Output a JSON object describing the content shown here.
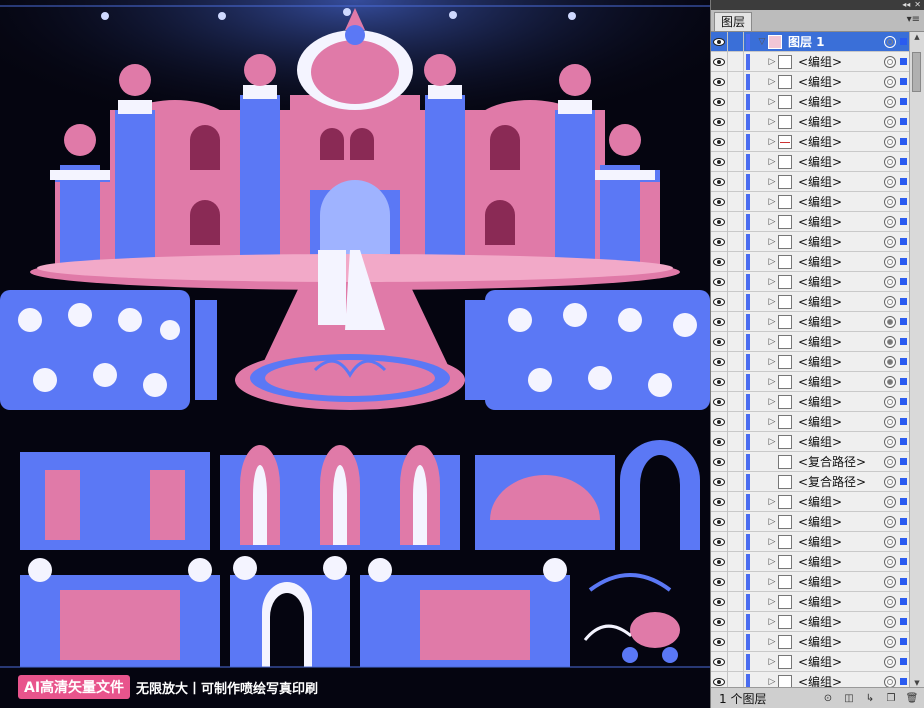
{
  "canvas": {
    "banner": {
      "badge": "AI高清矢量文件",
      "tagline": "无限放大丨可制作喷绘写真印刷"
    },
    "colors": {
      "blue": "#5b78f5",
      "pink": "#e07aa8",
      "white": "#f4f4ff",
      "bg": "#050510"
    }
  },
  "panel": {
    "tab_label": "图层",
    "footer_count": "1 个图层",
    "layers": [
      {
        "name": "图层 1",
        "kind": "layer"
      },
      {
        "name": "<编组>",
        "kind": "group",
        "thumb": "plain",
        "target": "empty"
      },
      {
        "name": "<编组>",
        "kind": "group",
        "thumb": "plain",
        "target": "empty"
      },
      {
        "name": "<编组>",
        "kind": "group",
        "thumb": "plain",
        "target": "empty"
      },
      {
        "name": "<编组>",
        "kind": "group",
        "thumb": "plain",
        "target": "empty"
      },
      {
        "name": "<编组>",
        "kind": "group",
        "thumb": "red",
        "target": "empty"
      },
      {
        "name": "<编组>",
        "kind": "group",
        "thumb": "plain",
        "target": "empty"
      },
      {
        "name": "<编组>",
        "kind": "group",
        "thumb": "plain",
        "target": "empty"
      },
      {
        "name": "<编组>",
        "kind": "group",
        "thumb": "plain",
        "target": "empty"
      },
      {
        "name": "<编组>",
        "kind": "group",
        "thumb": "plain",
        "target": "empty"
      },
      {
        "name": "<编组>",
        "kind": "group",
        "thumb": "plain",
        "target": "empty"
      },
      {
        "name": "<编组>",
        "kind": "group",
        "thumb": "plain",
        "target": "empty"
      },
      {
        "name": "<编组>",
        "kind": "group",
        "thumb": "plain",
        "target": "empty"
      },
      {
        "name": "<编组>",
        "kind": "group",
        "thumb": "plain",
        "target": "empty"
      },
      {
        "name": "<编组>",
        "kind": "group",
        "thumb": "plain",
        "target": "filled"
      },
      {
        "name": "<编组>",
        "kind": "group",
        "thumb": "plain",
        "target": "filled"
      },
      {
        "name": "<编组>",
        "kind": "group",
        "thumb": "plain",
        "target": "filled"
      },
      {
        "name": "<编组>",
        "kind": "group",
        "thumb": "plain",
        "target": "filled"
      },
      {
        "name": "<编组>",
        "kind": "group",
        "thumb": "plain",
        "target": "empty"
      },
      {
        "name": "<编组>",
        "kind": "group",
        "thumb": "plain",
        "target": "empty"
      },
      {
        "name": "<编组>",
        "kind": "group",
        "thumb": "plain",
        "target": "empty"
      },
      {
        "name": "<复合路径>",
        "kind": "path",
        "thumb": "plain",
        "target": "empty"
      },
      {
        "name": "<复合路径>",
        "kind": "path",
        "thumb": "plain",
        "target": "empty"
      },
      {
        "name": "<编组>",
        "kind": "group",
        "thumb": "plain",
        "target": "empty"
      },
      {
        "name": "<编组>",
        "kind": "group",
        "thumb": "plain",
        "target": "empty"
      },
      {
        "name": "<编组>",
        "kind": "group",
        "thumb": "plain",
        "target": "empty"
      },
      {
        "name": "<编组>",
        "kind": "group",
        "thumb": "plain",
        "target": "empty"
      },
      {
        "name": "<编组>",
        "kind": "group",
        "thumb": "plain",
        "target": "empty"
      },
      {
        "name": "<编组>",
        "kind": "group",
        "thumb": "plain",
        "target": "empty"
      },
      {
        "name": "<编组>",
        "kind": "group",
        "thumb": "plain",
        "target": "empty"
      },
      {
        "name": "<编组>",
        "kind": "group",
        "thumb": "plain",
        "target": "empty"
      },
      {
        "name": "<编组>",
        "kind": "group",
        "thumb": "plain",
        "target": "empty"
      },
      {
        "name": "<编组>",
        "kind": "group",
        "thumb": "plain",
        "target": "empty"
      },
      {
        "name": "<编组>",
        "kind": "group",
        "thumb": "plain",
        "target": "empty"
      }
    ]
  }
}
